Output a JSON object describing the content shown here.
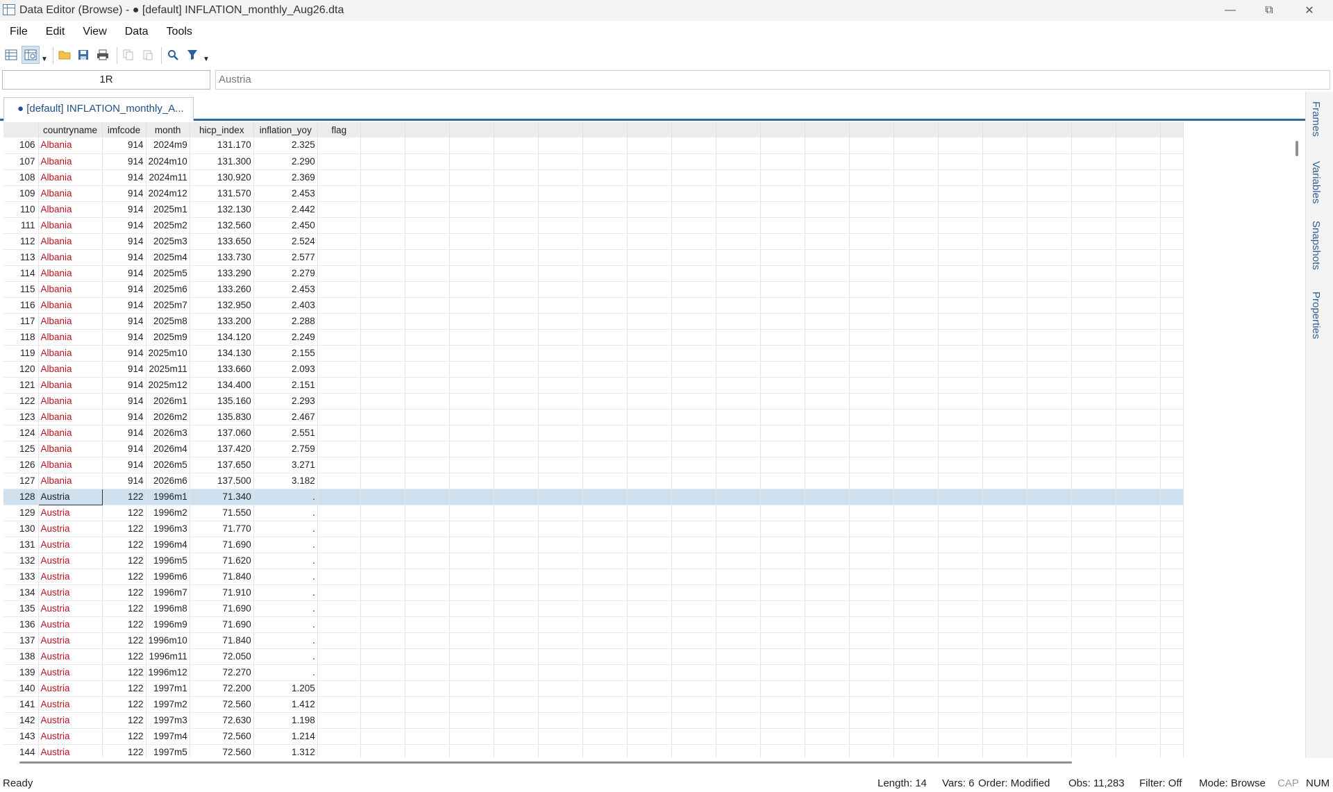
{
  "window": {
    "title": "Data Editor (Browse) - ● [default] INFLATION_monthly_Aug26.dta",
    "minimize": "—",
    "restore": "⧉",
    "close": "✕"
  },
  "menu": [
    "File",
    "Edit",
    "View",
    "Data",
    "Tools"
  ],
  "toolbar": {
    "icons": [
      "data-editor-edit-icon",
      "data-editor-browse-icon",
      "open-icon",
      "save-icon",
      "print-icon",
      "copy-icon",
      "paste-icon",
      "find-icon",
      "filter-icon"
    ]
  },
  "editbar": {
    "cell_ref": "1R",
    "cell_value": "Austria"
  },
  "tab": {
    "label": "● [default] INFLATION_monthly_A..."
  },
  "sidepanel": [
    "Frames",
    "Variables",
    "Snapshots",
    "Properties"
  ],
  "grid": {
    "columns": [
      "countryname",
      "imfcode",
      "month",
      "hicp_index",
      "inflation_yoy",
      "flag"
    ],
    "selected_row": "128",
    "rows": [
      [
        "106",
        "Albania",
        "914",
        "2024m9",
        "131.170",
        "2.325"
      ],
      [
        "107",
        "Albania",
        "914",
        "2024m10",
        "131.300",
        "2.290"
      ],
      [
        "108",
        "Albania",
        "914",
        "2024m11",
        "130.920",
        "2.369"
      ],
      [
        "109",
        "Albania",
        "914",
        "2024m12",
        "131.570",
        "2.453"
      ],
      [
        "110",
        "Albania",
        "914",
        "2025m1",
        "132.130",
        "2.442"
      ],
      [
        "111",
        "Albania",
        "914",
        "2025m2",
        "132.560",
        "2.450"
      ],
      [
        "112",
        "Albania",
        "914",
        "2025m3",
        "133.650",
        "2.524"
      ],
      [
        "113",
        "Albania",
        "914",
        "2025m4",
        "133.730",
        "2.577"
      ],
      [
        "114",
        "Albania",
        "914",
        "2025m5",
        "133.290",
        "2.279"
      ],
      [
        "115",
        "Albania",
        "914",
        "2025m6",
        "133.260",
        "2.453"
      ],
      [
        "116",
        "Albania",
        "914",
        "2025m7",
        "132.950",
        "2.403"
      ],
      [
        "117",
        "Albania",
        "914",
        "2025m8",
        "133.200",
        "2.288"
      ],
      [
        "118",
        "Albania",
        "914",
        "2025m9",
        "134.120",
        "2.249"
      ],
      [
        "119",
        "Albania",
        "914",
        "2025m10",
        "134.130",
        "2.155"
      ],
      [
        "120",
        "Albania",
        "914",
        "2025m11",
        "133.660",
        "2.093"
      ],
      [
        "121",
        "Albania",
        "914",
        "2025m12",
        "134.400",
        "2.151"
      ],
      [
        "122",
        "Albania",
        "914",
        "2026m1",
        "135.160",
        "2.293"
      ],
      [
        "123",
        "Albania",
        "914",
        "2026m2",
        "135.830",
        "2.467"
      ],
      [
        "124",
        "Albania",
        "914",
        "2026m3",
        "137.060",
        "2.551"
      ],
      [
        "125",
        "Albania",
        "914",
        "2026m4",
        "137.420",
        "2.759"
      ],
      [
        "126",
        "Albania",
        "914",
        "2026m5",
        "137.650",
        "3.271"
      ],
      [
        "127",
        "Albania",
        "914",
        "2026m6",
        "137.500",
        "3.182"
      ],
      [
        "128",
        "Austria",
        "122",
        "1996m1",
        "71.340",
        "."
      ],
      [
        "129",
        "Austria",
        "122",
        "1996m2",
        "71.550",
        "."
      ],
      [
        "130",
        "Austria",
        "122",
        "1996m3",
        "71.770",
        "."
      ],
      [
        "131",
        "Austria",
        "122",
        "1996m4",
        "71.690",
        "."
      ],
      [
        "132",
        "Austria",
        "122",
        "1996m5",
        "71.620",
        "."
      ],
      [
        "133",
        "Austria",
        "122",
        "1996m6",
        "71.840",
        "."
      ],
      [
        "134",
        "Austria",
        "122",
        "1996m7",
        "71.910",
        "."
      ],
      [
        "135",
        "Austria",
        "122",
        "1996m8",
        "71.690",
        "."
      ],
      [
        "136",
        "Austria",
        "122",
        "1996m9",
        "71.690",
        "."
      ],
      [
        "137",
        "Austria",
        "122",
        "1996m10",
        "71.840",
        "."
      ],
      [
        "138",
        "Austria",
        "122",
        "1996m11",
        "72.050",
        "."
      ],
      [
        "139",
        "Austria",
        "122",
        "1996m12",
        "72.270",
        "."
      ],
      [
        "140",
        "Austria",
        "122",
        "1997m1",
        "72.200",
        "1.205"
      ],
      [
        "141",
        "Austria",
        "122",
        "1997m2",
        "72.560",
        "1.412"
      ],
      [
        "142",
        "Austria",
        "122",
        "1997m3",
        "72.630",
        "1.198"
      ],
      [
        "143",
        "Austria",
        "122",
        "1997m4",
        "72.560",
        "1.214"
      ],
      [
        "144",
        "Austria",
        "122",
        "1997m5",
        "72.560",
        "1.312"
      ]
    ]
  },
  "status": {
    "ready": "Ready",
    "length": "Length: 14",
    "vars": "Vars: 6",
    "order": "Order: Modified",
    "obs": "Obs: 11,283",
    "filter": "Filter: Off",
    "mode": "Mode: Browse",
    "cap": "CAP",
    "num": "NUM"
  }
}
